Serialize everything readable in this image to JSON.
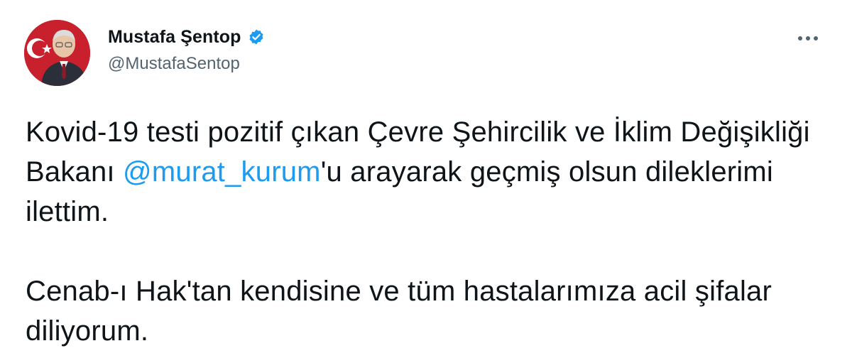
{
  "author": {
    "display_name": "Mustafa Şentop",
    "handle": "@MustafaSentop",
    "verified": true,
    "avatar_icon": "profile-photo"
  },
  "menu": {
    "more_icon": "more-horizontal-icon"
  },
  "tweet": {
    "paragraph1": {
      "before": "Kovid-19 testi pozitif çıkan Çevre Şehircilik ve İklim Değişikliği Bakanı ",
      "mention": "@murat_kurum",
      "after": "'u arayarak geçmiş olsun dileklerimi ilettim."
    },
    "paragraph2": "Cenab-ı Hak'tan kendisine ve tüm hastalarımıza acil şifalar diliyorum."
  },
  "colors": {
    "text": "#0f1419",
    "secondary": "#536471",
    "accent": "#1d9bf0",
    "background": "#ffffff"
  }
}
